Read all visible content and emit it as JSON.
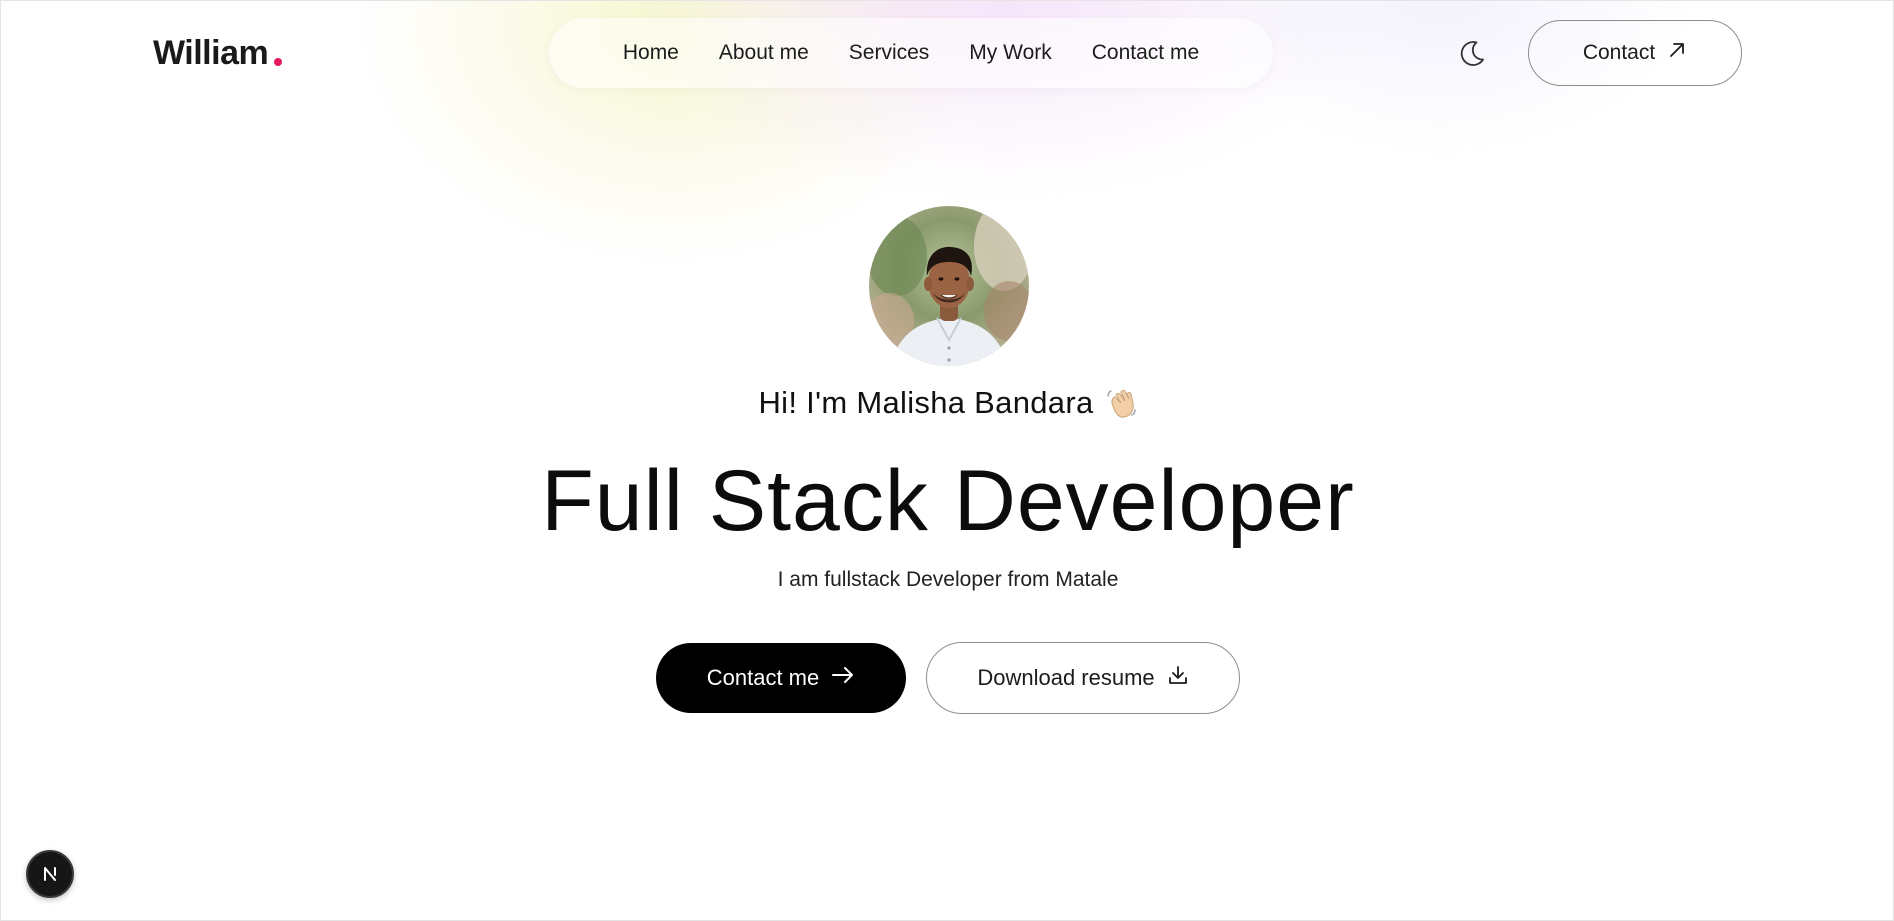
{
  "header": {
    "logo_text": "William",
    "logo_dot_color": "#e8185c",
    "nav_items": [
      {
        "label": "Home"
      },
      {
        "label": "About me"
      },
      {
        "label": "Services"
      },
      {
        "label": "My Work"
      },
      {
        "label": "Contact me"
      }
    ],
    "theme_toggle_icon": "moon-icon",
    "contact_button_label": "Contact",
    "contact_button_icon": "arrow-up-right-icon"
  },
  "hero": {
    "profile_image": "profile-photo",
    "greeting": "Hi! I'm Malisha Bandara",
    "greeting_icon": "waving-hand-icon",
    "headline": "Full Stack Developer",
    "subtitle": "I am fullstack Developer from Matale",
    "primary_button_label": "Contact me",
    "primary_button_icon": "arrow-right-icon",
    "secondary_button_label": "Download resume",
    "secondary_button_icon": "download-icon"
  },
  "dev_badge": {
    "icon": "nextjs-logo-icon"
  },
  "colors": {
    "background": "#ffffff",
    "primary_button_bg": "#000000",
    "accent_dot": "#e8185c"
  }
}
